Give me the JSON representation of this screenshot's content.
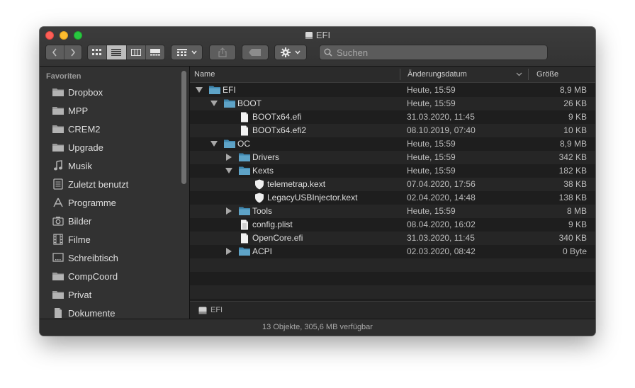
{
  "window": {
    "title": "EFI"
  },
  "toolbar": {
    "search_placeholder": "Suchen"
  },
  "sidebar": {
    "heading": "Favoriten",
    "items": [
      {
        "label": "Dropbox",
        "icon": "folder-icon"
      },
      {
        "label": "MPP",
        "icon": "folder-icon"
      },
      {
        "label": "CREM2",
        "icon": "folder-icon"
      },
      {
        "label": "Upgrade",
        "icon": "folder-icon"
      },
      {
        "label": "Musik",
        "icon": "music-note-icon"
      },
      {
        "label": "Zuletzt benutzt",
        "icon": "recents-icon"
      },
      {
        "label": "Programme",
        "icon": "applications-icon"
      },
      {
        "label": "Bilder",
        "icon": "camera-icon"
      },
      {
        "label": "Filme",
        "icon": "film-icon"
      },
      {
        "label": "Schreibtisch",
        "icon": "desktop-icon"
      },
      {
        "label": "CompCoord",
        "icon": "folder-icon"
      },
      {
        "label": "Privat",
        "icon": "folder-icon"
      },
      {
        "label": "Dokumente",
        "icon": "document-icon"
      }
    ]
  },
  "columns": {
    "name": "Name",
    "date": "Änderungsdatum",
    "size": "Größe"
  },
  "files": [
    {
      "name": "EFI",
      "date": "Heute, 15:59",
      "size": "8,9 MB"
    },
    {
      "name": "BOOT",
      "date": "Heute, 15:59",
      "size": "26 KB"
    },
    {
      "name": "BOOTx64.efi",
      "date": "31.03.2020, 11:45",
      "size": "9 KB"
    },
    {
      "name": "BOOTx64.efi2",
      "date": "08.10.2019, 07:40",
      "size": "10 KB"
    },
    {
      "name": "OC",
      "date": "Heute, 15:59",
      "size": "8,9 MB"
    },
    {
      "name": "Drivers",
      "date": "Heute, 15:59",
      "size": "342 KB"
    },
    {
      "name": "Kexts",
      "date": "Heute, 15:59",
      "size": "182 KB"
    },
    {
      "name": "telemetrap.kext",
      "date": "07.04.2020, 17:56",
      "size": "38 KB"
    },
    {
      "name": "LegacyUSBInjector.kext",
      "date": "02.04.2020, 14:48",
      "size": "138 KB"
    },
    {
      "name": "Tools",
      "date": "Heute, 15:59",
      "size": "8 MB"
    },
    {
      "name": "config.plist",
      "date": "08.04.2020, 16:02",
      "size": "9 KB"
    },
    {
      "name": "OpenCore.efi",
      "date": "31.03.2020, 11:45",
      "size": "340 KB"
    },
    {
      "name": "ACPI",
      "date": "02.03.2020, 08:42",
      "size": "0 Byte"
    }
  ],
  "pathbar": {
    "label": "EFI"
  },
  "status": {
    "text": "13 Objekte, 305,6 MB verfügbar"
  },
  "colors": {
    "folder": "#5ea3c7",
    "window_bg": "#1e1e1e",
    "sidebar_bg": "#323232"
  }
}
